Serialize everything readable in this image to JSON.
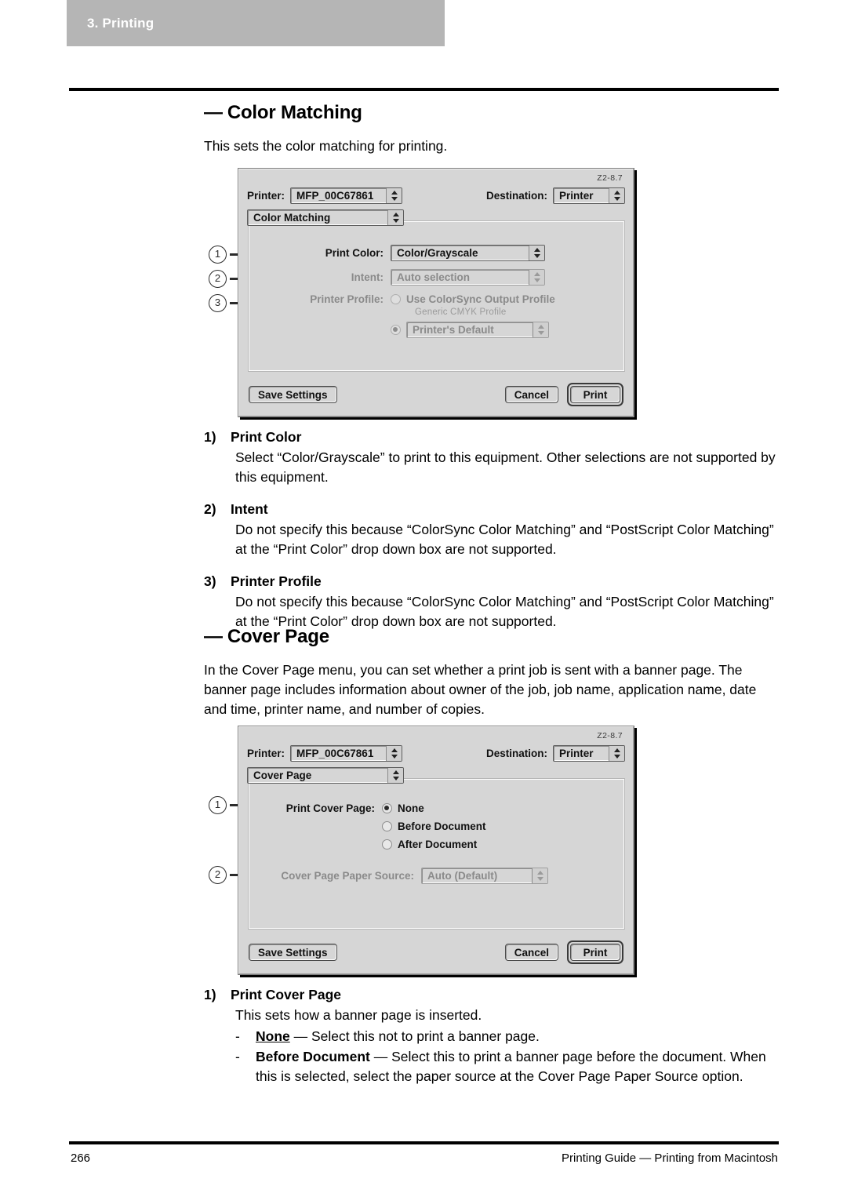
{
  "chapter_tab": {
    "label": "3. Printing"
  },
  "sections": [
    {
      "heading": "Color Matching",
      "dash": "—",
      "intro": "This sets the color matching for printing.",
      "items": [
        {
          "n": "1)",
          "title": "Print Color",
          "body": "Select “Color/Grayscale” to print to this equipment.  Other selections are not supported by this equipment."
        },
        {
          "n": "2)",
          "title": "Intent",
          "body": "Do not specify this because “ColorSync Color Matching” and “PostScript Color Matching” at the “Print Color” drop down box are not supported."
        },
        {
          "n": "3)",
          "title": "Printer Profile",
          "body": "Do not specify this because “ColorSync Color Matching” and “PostScript Color Matching” at the “Print Color” drop down box are not supported."
        }
      ]
    },
    {
      "heading": "Cover Page",
      "dash": "—",
      "intro": "In the Cover Page menu, you can set whether a print job is sent with a banner page. The banner page includes information about owner of the job, job name, application name, date and time, printer name, and number of copies.",
      "items": [
        {
          "n": "1)",
          "title": "Print Cover Page",
          "body": "This sets how a banner page is inserted."
        }
      ],
      "bullets": [
        {
          "dash": "-",
          "term": "None",
          "term_style": "underline-bold",
          "rest": " — Select this not to print a banner page."
        },
        {
          "dash": "-",
          "term": "Before Document",
          "term_style": "bold",
          "rest": " — Select this to print a banner page before the document. When this is selected, select the paper source at the Cover Page Paper Source option."
        }
      ]
    }
  ],
  "dialog_color_matching": {
    "version_tag": "Z2-8.7",
    "printer_label": "Printer:",
    "printer_value": "MFP_00C67861",
    "destination_label": "Destination:",
    "destination_value": "Printer",
    "panel_value": "Color Matching",
    "print_color_label": "Print Color:",
    "print_color_value": "Color/Grayscale",
    "intent_label": "Intent:",
    "intent_value": "Auto selection",
    "printer_profile_label": "Printer Profile:",
    "colorsync_option_label": "Use ColorSync Output Profile",
    "colorsync_sub_note": "Generic CMYK Profile",
    "printers_default_value": "Printer's Default",
    "save_settings_label": "Save Settings",
    "cancel_label": "Cancel",
    "print_label": "Print",
    "callouts": [
      "1",
      "2",
      "3"
    ]
  },
  "dialog_cover_page": {
    "version_tag": "Z2-8.7",
    "printer_label": "Printer:",
    "printer_value": "MFP_00C67861",
    "destination_label": "Destination:",
    "destination_value": "Printer",
    "panel_value": "Cover Page",
    "print_cover_page_label": "Print Cover Page:",
    "option_none": "None",
    "option_before": "Before Document",
    "option_after": "After Document",
    "paper_source_label": "Cover Page Paper Source:",
    "paper_source_value": "Auto (Default)",
    "save_settings_label": "Save Settings",
    "cancel_label": "Cancel",
    "print_label": "Print",
    "callouts": [
      "1",
      "2"
    ]
  },
  "footer": {
    "page_number": "266",
    "title": "Printing Guide — Printing from Macintosh"
  }
}
